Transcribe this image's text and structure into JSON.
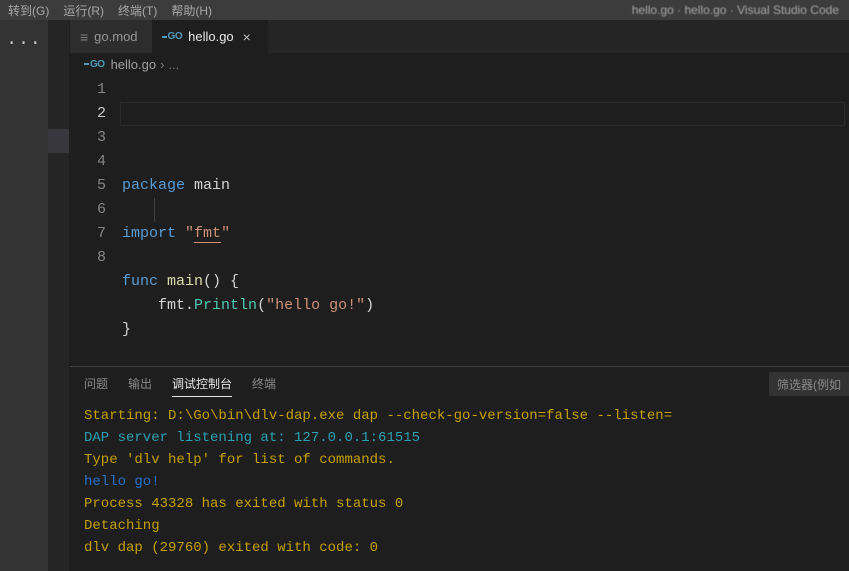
{
  "menubar": {
    "items": [
      "转到(G)",
      "运行(R)",
      "终端(T)",
      "帮助(H)"
    ],
    "title_fragment": "hello.go · hello.go · Visual Studio Code"
  },
  "tabs": [
    {
      "icon": "mod",
      "label": "go.mod",
      "active": false,
      "closeable": false
    },
    {
      "icon": "go",
      "label": "hello.go",
      "active": true,
      "closeable": true
    }
  ],
  "breadcrumb": {
    "icon": "go",
    "file": "hello.go",
    "separator": "›",
    "tail": "..."
  },
  "code": {
    "current_line": 2,
    "lines": [
      {
        "n": 1,
        "segments": [
          {
            "cls": "kw",
            "t": "package"
          },
          {
            "cls": "punc",
            "t": " "
          },
          {
            "cls": "ident",
            "t": "main"
          }
        ]
      },
      {
        "n": 2,
        "segments": []
      },
      {
        "n": 3,
        "segments": [
          {
            "cls": "kw",
            "t": "import"
          },
          {
            "cls": "punc",
            "t": " "
          },
          {
            "cls": "str",
            "t": "\""
          },
          {
            "cls": "str str-underline",
            "t": "fmt"
          },
          {
            "cls": "str",
            "t": "\""
          }
        ]
      },
      {
        "n": 4,
        "segments": []
      },
      {
        "n": 5,
        "segments": [
          {
            "cls": "kw",
            "t": "func"
          },
          {
            "cls": "punc",
            "t": " "
          },
          {
            "cls": "fn",
            "t": "main"
          },
          {
            "cls": "punc",
            "t": "() {"
          }
        ]
      },
      {
        "n": 6,
        "segments": [
          {
            "cls": "punc",
            "t": "    "
          },
          {
            "cls": "ident",
            "t": "fmt"
          },
          {
            "cls": "punc",
            "t": "."
          },
          {
            "cls": "typecall",
            "t": "Println"
          },
          {
            "cls": "punc",
            "t": "("
          },
          {
            "cls": "str",
            "t": "\"hello go!\""
          },
          {
            "cls": "punc",
            "t": ")"
          }
        ]
      },
      {
        "n": 7,
        "segments": [
          {
            "cls": "punc",
            "t": "}"
          }
        ]
      },
      {
        "n": 8,
        "segments": []
      }
    ]
  },
  "panel": {
    "tabs": [
      "问题",
      "输出",
      "调试控制台",
      "终端"
    ],
    "active_tab_index": 2,
    "filter_placeholder": "筛选器(例如",
    "lines": [
      {
        "cls": "c-yellow",
        "t": "Starting: D:\\Go\\bin\\dlv-dap.exe dap --check-go-version=false --listen="
      },
      {
        "cls": "c-cyan",
        "t": "DAP server listening at: 127.0.0.1:61515"
      },
      {
        "cls": "c-yellow",
        "t": "Type 'dlv help' for list of commands."
      },
      {
        "cls": "c-blue",
        "t": "hello go!"
      },
      {
        "cls": "c-yellow",
        "t": "Process 43328 has exited with status 0"
      },
      {
        "cls": "c-yellow",
        "t": "Detaching"
      },
      {
        "cls": "c-yellow",
        "t": "dlv dap (29760) exited with code: 0"
      }
    ]
  }
}
